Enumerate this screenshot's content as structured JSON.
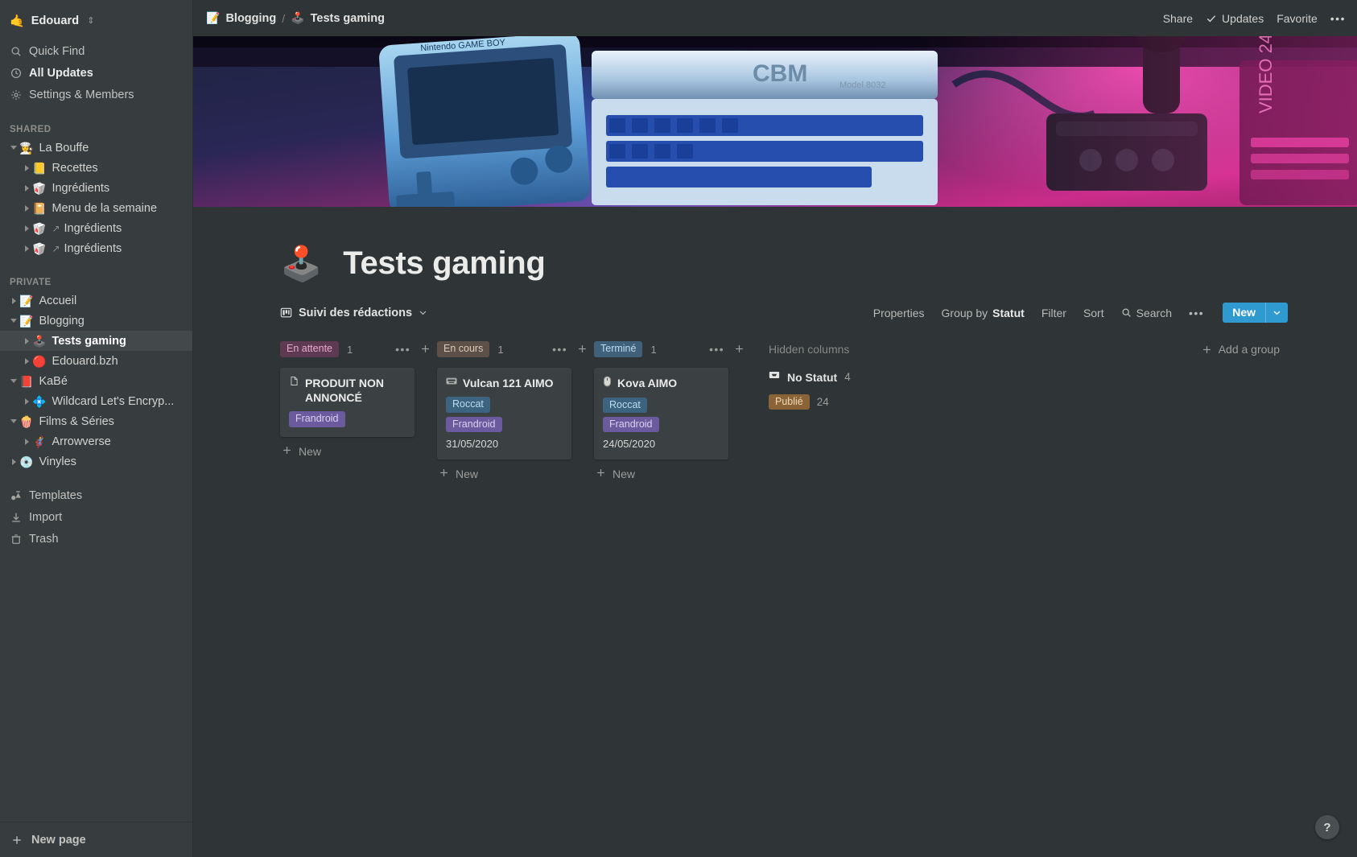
{
  "workspace": {
    "emoji": "🤙",
    "name": "Edouard"
  },
  "sidebar": {
    "nav": [
      {
        "label": "Quick Find",
        "icon": "search-icon"
      },
      {
        "label": "All Updates",
        "icon": "clock-icon"
      },
      {
        "label": "Settings & Members",
        "icon": "gear-icon"
      }
    ],
    "shared_label": "SHARED",
    "shared": [
      {
        "label": "La Bouffe",
        "emoji": "👩‍🍳",
        "depth": 0,
        "expanded": true,
        "link": false
      },
      {
        "label": "Recettes",
        "emoji": "📒",
        "depth": 1,
        "expanded": false,
        "link": false
      },
      {
        "label": "Ingrédients",
        "emoji": "🥡",
        "depth": 1,
        "expanded": false,
        "link": false
      },
      {
        "label": "Menu de la semaine",
        "emoji": "📔",
        "depth": 1,
        "expanded": false,
        "link": false
      },
      {
        "label": "Ingrédients",
        "emoji": "🥡",
        "depth": 1,
        "expanded": false,
        "link": true
      },
      {
        "label": "Ingrédients",
        "emoji": "🥡",
        "depth": 1,
        "expanded": false,
        "link": true
      }
    ],
    "private_label": "PRIVATE",
    "private": [
      {
        "label": "Accueil",
        "emoji": "📝",
        "depth": 0,
        "expanded": false,
        "link": false,
        "selected": false
      },
      {
        "label": "Blogging",
        "emoji": "📝",
        "depth": 0,
        "expanded": true,
        "link": false,
        "selected": false
      },
      {
        "label": "Tests gaming",
        "emoji": "🕹️",
        "depth": 1,
        "expanded": false,
        "link": false,
        "selected": true
      },
      {
        "label": "Edouard.bzh",
        "emoji": "🔴",
        "depth": 1,
        "expanded": false,
        "link": false,
        "selected": false
      },
      {
        "label": "KaBé",
        "emoji": "📕",
        "depth": 0,
        "expanded": true,
        "link": false,
        "selected": false
      },
      {
        "label": "Wildcard Let's Encryp...",
        "emoji": "💠",
        "depth": 1,
        "expanded": false,
        "link": false,
        "selected": false
      },
      {
        "label": "Films & Séries",
        "emoji": "🍿",
        "depth": 0,
        "expanded": true,
        "link": false,
        "selected": false
      },
      {
        "label": "Arrowverse",
        "emoji": "🦸",
        "depth": 1,
        "expanded": false,
        "link": false,
        "selected": false
      },
      {
        "label": "Vinyles",
        "emoji": "💿",
        "depth": 0,
        "expanded": false,
        "link": false,
        "selected": false
      }
    ],
    "utility": [
      {
        "label": "Templates",
        "icon": "templates-icon"
      },
      {
        "label": "Import",
        "icon": "import-icon"
      },
      {
        "label": "Trash",
        "icon": "trash-icon"
      }
    ],
    "new_page": {
      "label": "New page",
      "icon": "plus-icon"
    }
  },
  "topbar": {
    "breadcrumb": [
      {
        "label": "Blogging",
        "emoji": "📝"
      },
      {
        "label": "Tests gaming",
        "emoji": "🕹️"
      }
    ],
    "separator": "/",
    "share": "Share",
    "updates": "Updates",
    "favorite": "Favorite",
    "more": "•••"
  },
  "page": {
    "emoji": "🕹️",
    "title": "Tests gaming"
  },
  "view": {
    "name": "Suivi des rédactions",
    "chevron": "⌄",
    "actions": {
      "properties": "Properties",
      "group_by_prefix": "Group by ",
      "group_by_value": "Statut",
      "filter": "Filter",
      "sort": "Sort",
      "search": "Search",
      "more": "•••",
      "new": "New"
    }
  },
  "board": {
    "columns": [
      {
        "name": "En attente",
        "chip_bg": "#5e3a52",
        "chip_fg": "#e6a9d0",
        "count": "1",
        "new_label": "New",
        "cards": [
          {
            "title": "PRODUIT NON ANNONCÉ",
            "icon": "document-icon",
            "tags": [
              {
                "label": "Frandroid",
                "bg": "#6c5a9e",
                "fg": "#d9d2f0"
              }
            ],
            "date": ""
          }
        ]
      },
      {
        "name": "En cours",
        "chip_bg": "#5c5048",
        "chip_fg": "#ddc9b8",
        "count": "1",
        "new_label": "New",
        "cards": [
          {
            "title": "Vulcan 121 AIMO",
            "icon": "keyboard-icon",
            "tags": [
              {
                "label": "Roccat",
                "bg": "#3c6480",
                "fg": "#bcdcef"
              },
              {
                "label": "Frandroid",
                "bg": "#6c5a9e",
                "fg": "#d9d2f0"
              }
            ],
            "date": "31/05/2020"
          }
        ]
      },
      {
        "name": "Terminé",
        "chip_bg": "#3f6179",
        "chip_fg": "#bcdcef",
        "count": "1",
        "new_label": "New",
        "cards": [
          {
            "title": "Kova AIMO",
            "icon": "mouse-icon",
            "tags": [
              {
                "label": "Roccat",
                "bg": "#3c6480",
                "fg": "#bcdcef"
              },
              {
                "label": "Frandroid",
                "bg": "#6c5a9e",
                "fg": "#d9d2f0"
              }
            ],
            "date": "24/05/2020"
          }
        ]
      }
    ],
    "hidden": {
      "title": "Hidden columns",
      "add_group": "Add a group",
      "rows": [
        {
          "label": "No Statut",
          "count": "4",
          "type": "icon",
          "icon": "inbox-icon"
        },
        {
          "label": "Publié",
          "count": "24",
          "type": "chip",
          "bg": "#8a6437",
          "fg": "#f0d9b8"
        }
      ]
    }
  },
  "help": {
    "label": "?"
  }
}
